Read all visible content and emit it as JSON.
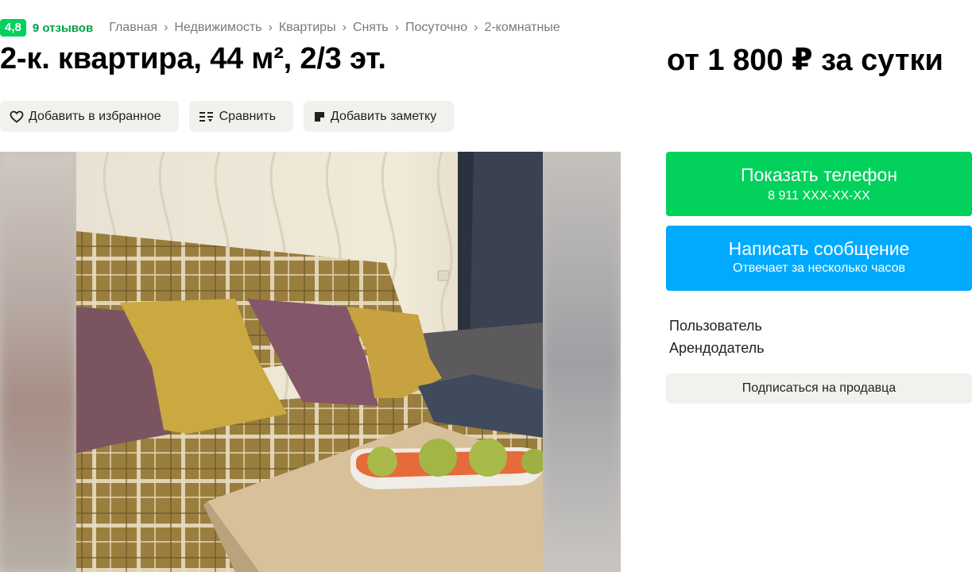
{
  "header": {
    "rating": "4,8",
    "reviews": "9 отзывов",
    "breadcrumbs": [
      {
        "label": "Главная"
      },
      {
        "label": "Недвижимость"
      },
      {
        "label": "Квартиры"
      },
      {
        "label": "Снять"
      },
      {
        "label": "Посуточно"
      },
      {
        "label": "2-комнатные"
      }
    ],
    "breadcrumb_separator": "›"
  },
  "listing": {
    "title": "2-к. квартира, 44 м², 2/3 эт.",
    "price": "от 1 800 ₽ за сутки"
  },
  "actions": {
    "favorite": {
      "label": "Добавить в избранное",
      "icon": "heart-icon"
    },
    "compare": {
      "label": "Сравнить",
      "icon": "compare-icon"
    },
    "note": {
      "label": "Добавить заметку",
      "icon": "note-icon"
    }
  },
  "contact": {
    "phone_label": "Показать телефон",
    "phone_number": "8 911 XXX-XX-XX",
    "message_label": "Написать сообщение",
    "message_sub": "Отвечает за несколько часов"
  },
  "seller": {
    "name": "Пользователь",
    "type": "Арендодатель",
    "subscribe": "Подписаться на продавца"
  },
  "colors": {
    "green": "#02d15c",
    "blue": "#00aaff",
    "button_bg": "#f2f1ee",
    "link_green": "#00a046"
  }
}
